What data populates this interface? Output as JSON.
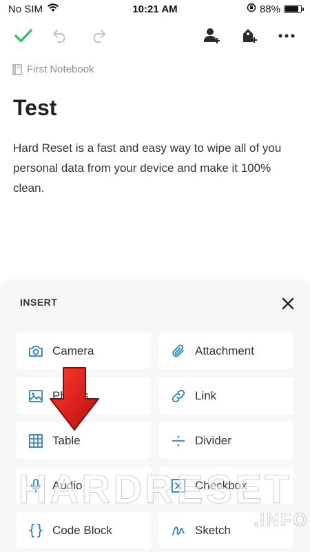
{
  "status_bar": {
    "carrier": "No SIM",
    "time": "10:21 AM",
    "battery_text": "88%",
    "battery_level": 0.88
  },
  "toolbar": {
    "done_icon": "check-icon",
    "undo_icon": "undo-icon",
    "redo_icon": "redo-icon",
    "share_icon": "add-person-icon",
    "tag_icon": "add-tag-icon",
    "more_icon": "more-icon",
    "accent_color": "#2dbe60"
  },
  "note": {
    "notebook": "First Notebook",
    "title": "Test",
    "body": "Hard Reset is a fast and easy way to wipe all of you personal data from your device and make it 100% clean."
  },
  "insert_sheet": {
    "title": "INSERT",
    "icon_color": "#2a7fb8",
    "items": [
      {
        "label": "Camera",
        "icon": "camera-icon"
      },
      {
        "label": "Attachment",
        "icon": "paperclip-icon"
      },
      {
        "label": "Photos",
        "icon": "image-icon"
      },
      {
        "label": "Link",
        "icon": "link-icon"
      },
      {
        "label": "Table",
        "icon": "table-icon"
      },
      {
        "label": "Divider",
        "icon": "divider-icon"
      },
      {
        "label": "Audio",
        "icon": "microphone-icon"
      },
      {
        "label": "Checkbox",
        "icon": "checkbox-icon"
      },
      {
        "label": "Code Block",
        "icon": "code-block-icon"
      },
      {
        "label": "Sketch",
        "icon": "sketch-icon"
      }
    ]
  },
  "watermark": {
    "main": "HARDRESET",
    "sub": ".INFO"
  }
}
